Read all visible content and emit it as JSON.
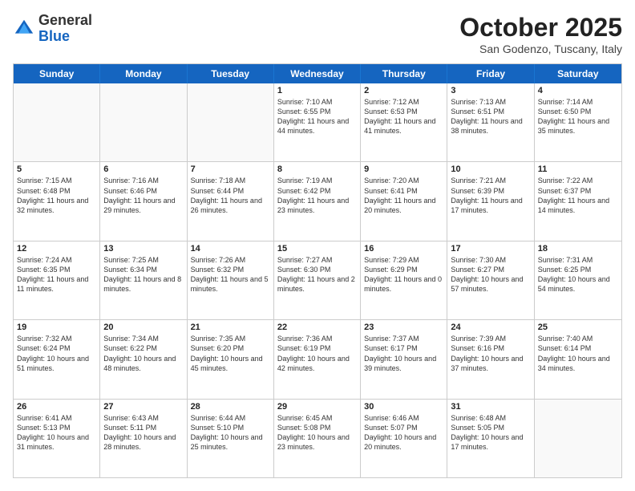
{
  "header": {
    "logo_general": "General",
    "logo_blue": "Blue",
    "month_title": "October 2025",
    "subtitle": "San Godenzo, Tuscany, Italy"
  },
  "days_of_week": [
    "Sunday",
    "Monday",
    "Tuesday",
    "Wednesday",
    "Thursday",
    "Friday",
    "Saturday"
  ],
  "rows": [
    [
      {
        "day": "",
        "text": "",
        "empty": true
      },
      {
        "day": "",
        "text": "",
        "empty": true
      },
      {
        "day": "",
        "text": "",
        "empty": true
      },
      {
        "day": "1",
        "text": "Sunrise: 7:10 AM\nSunset: 6:55 PM\nDaylight: 11 hours and 44 minutes.",
        "empty": false
      },
      {
        "day": "2",
        "text": "Sunrise: 7:12 AM\nSunset: 6:53 PM\nDaylight: 11 hours and 41 minutes.",
        "empty": false
      },
      {
        "day": "3",
        "text": "Sunrise: 7:13 AM\nSunset: 6:51 PM\nDaylight: 11 hours and 38 minutes.",
        "empty": false
      },
      {
        "day": "4",
        "text": "Sunrise: 7:14 AM\nSunset: 6:50 PM\nDaylight: 11 hours and 35 minutes.",
        "empty": false
      }
    ],
    [
      {
        "day": "5",
        "text": "Sunrise: 7:15 AM\nSunset: 6:48 PM\nDaylight: 11 hours and 32 minutes.",
        "empty": false
      },
      {
        "day": "6",
        "text": "Sunrise: 7:16 AM\nSunset: 6:46 PM\nDaylight: 11 hours and 29 minutes.",
        "empty": false
      },
      {
        "day": "7",
        "text": "Sunrise: 7:18 AM\nSunset: 6:44 PM\nDaylight: 11 hours and 26 minutes.",
        "empty": false
      },
      {
        "day": "8",
        "text": "Sunrise: 7:19 AM\nSunset: 6:42 PM\nDaylight: 11 hours and 23 minutes.",
        "empty": false
      },
      {
        "day": "9",
        "text": "Sunrise: 7:20 AM\nSunset: 6:41 PM\nDaylight: 11 hours and 20 minutes.",
        "empty": false
      },
      {
        "day": "10",
        "text": "Sunrise: 7:21 AM\nSunset: 6:39 PM\nDaylight: 11 hours and 17 minutes.",
        "empty": false
      },
      {
        "day": "11",
        "text": "Sunrise: 7:22 AM\nSunset: 6:37 PM\nDaylight: 11 hours and 14 minutes.",
        "empty": false
      }
    ],
    [
      {
        "day": "12",
        "text": "Sunrise: 7:24 AM\nSunset: 6:35 PM\nDaylight: 11 hours and 11 minutes.",
        "empty": false
      },
      {
        "day": "13",
        "text": "Sunrise: 7:25 AM\nSunset: 6:34 PM\nDaylight: 11 hours and 8 minutes.",
        "empty": false
      },
      {
        "day": "14",
        "text": "Sunrise: 7:26 AM\nSunset: 6:32 PM\nDaylight: 11 hours and 5 minutes.",
        "empty": false
      },
      {
        "day": "15",
        "text": "Sunrise: 7:27 AM\nSunset: 6:30 PM\nDaylight: 11 hours and 2 minutes.",
        "empty": false
      },
      {
        "day": "16",
        "text": "Sunrise: 7:29 AM\nSunset: 6:29 PM\nDaylight: 11 hours and 0 minutes.",
        "empty": false
      },
      {
        "day": "17",
        "text": "Sunrise: 7:30 AM\nSunset: 6:27 PM\nDaylight: 10 hours and 57 minutes.",
        "empty": false
      },
      {
        "day": "18",
        "text": "Sunrise: 7:31 AM\nSunset: 6:25 PM\nDaylight: 10 hours and 54 minutes.",
        "empty": false
      }
    ],
    [
      {
        "day": "19",
        "text": "Sunrise: 7:32 AM\nSunset: 6:24 PM\nDaylight: 10 hours and 51 minutes.",
        "empty": false
      },
      {
        "day": "20",
        "text": "Sunrise: 7:34 AM\nSunset: 6:22 PM\nDaylight: 10 hours and 48 minutes.",
        "empty": false
      },
      {
        "day": "21",
        "text": "Sunrise: 7:35 AM\nSunset: 6:20 PM\nDaylight: 10 hours and 45 minutes.",
        "empty": false
      },
      {
        "day": "22",
        "text": "Sunrise: 7:36 AM\nSunset: 6:19 PM\nDaylight: 10 hours and 42 minutes.",
        "empty": false
      },
      {
        "day": "23",
        "text": "Sunrise: 7:37 AM\nSunset: 6:17 PM\nDaylight: 10 hours and 39 minutes.",
        "empty": false
      },
      {
        "day": "24",
        "text": "Sunrise: 7:39 AM\nSunset: 6:16 PM\nDaylight: 10 hours and 37 minutes.",
        "empty": false
      },
      {
        "day": "25",
        "text": "Sunrise: 7:40 AM\nSunset: 6:14 PM\nDaylight: 10 hours and 34 minutes.",
        "empty": false
      }
    ],
    [
      {
        "day": "26",
        "text": "Sunrise: 6:41 AM\nSunset: 5:13 PM\nDaylight: 10 hours and 31 minutes.",
        "empty": false
      },
      {
        "day": "27",
        "text": "Sunrise: 6:43 AM\nSunset: 5:11 PM\nDaylight: 10 hours and 28 minutes.",
        "empty": false
      },
      {
        "day": "28",
        "text": "Sunrise: 6:44 AM\nSunset: 5:10 PM\nDaylight: 10 hours and 25 minutes.",
        "empty": false
      },
      {
        "day": "29",
        "text": "Sunrise: 6:45 AM\nSunset: 5:08 PM\nDaylight: 10 hours and 23 minutes.",
        "empty": false
      },
      {
        "day": "30",
        "text": "Sunrise: 6:46 AM\nSunset: 5:07 PM\nDaylight: 10 hours and 20 minutes.",
        "empty": false
      },
      {
        "day": "31",
        "text": "Sunrise: 6:48 AM\nSunset: 5:05 PM\nDaylight: 10 hours and 17 minutes.",
        "empty": false
      },
      {
        "day": "",
        "text": "",
        "empty": true
      }
    ]
  ]
}
